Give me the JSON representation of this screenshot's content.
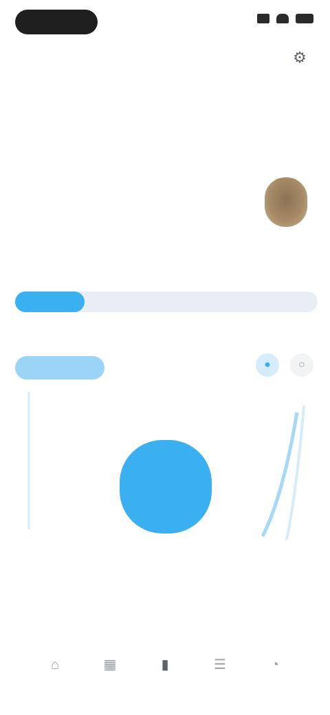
{
  "status_bar": {
    "time": ""
  },
  "nav": {
    "left_label": "",
    "title": "",
    "settings_icon": "gear-icon"
  },
  "calendar": {
    "month_label": "",
    "link_label": "",
    "week_days": [
      "",
      "",
      "",
      "",
      "",
      ""
    ],
    "week_dates": [
      "",
      "",
      "",
      "",
      "",
      ""
    ]
  },
  "progress": {
    "label": "",
    "value": 0.23
  },
  "section2": {
    "label": "",
    "badge": "",
    "badge_detail": ""
  },
  "chart": {
    "caption": ""
  },
  "description": {
    "text": "",
    "links": [
      "",
      "",
      ""
    ]
  },
  "tabs": [
    {
      "icon": "home-icon",
      "label": ""
    },
    {
      "icon": "calendar-icon",
      "label": ""
    },
    {
      "icon": "chart-icon",
      "label": ""
    },
    {
      "icon": "list-icon",
      "label": ""
    },
    {
      "icon": "profile-icon",
      "label": ""
    }
  ],
  "colors": {
    "accent": "#3ab0f0",
    "track": "#e8eef4",
    "text": "#5f6368"
  }
}
